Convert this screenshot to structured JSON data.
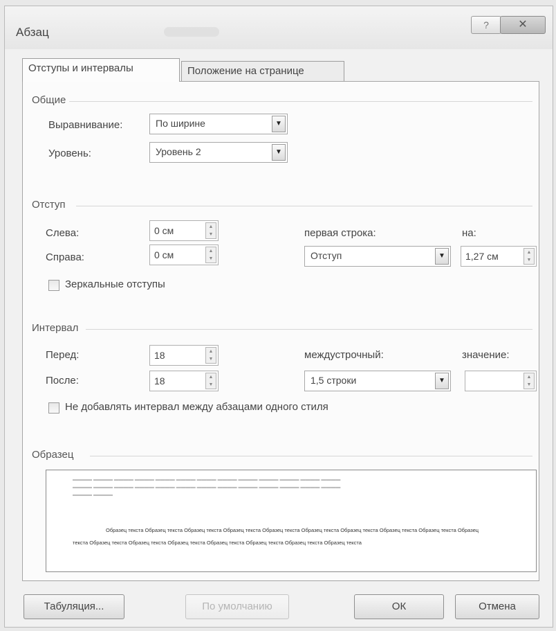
{
  "window": {
    "title": "Абзац",
    "help_icon": "?",
    "close_icon": "✕"
  },
  "tabs": [
    {
      "label": "Отступы и интервалы",
      "active": true
    },
    {
      "label": "Положение на странице",
      "active": false
    }
  ],
  "general": {
    "section": "Общие",
    "alignment_label": "Выравнивание:",
    "alignment_value": "По ширине",
    "level_label": "Уровень:",
    "level_value": "Уровень 2"
  },
  "indent": {
    "section": "Отступ",
    "left_label": "Слева:",
    "left_value": "0 см",
    "right_label": "Справа:",
    "right_value": "0 см",
    "first_line_label": "первая строка:",
    "first_line_value": "Отступ",
    "by_label": "на:",
    "by_value": "1,27 см",
    "mirror_label": "Зеркальные отступы"
  },
  "spacing": {
    "section": "Интервал",
    "before_label": "Перед:",
    "before_value": "18",
    "after_label": "После:",
    "after_value": "18",
    "line_label": "междустрочный:",
    "line_value": "1,5 строки",
    "at_label": "значение:",
    "at_value": "",
    "no_space_label": "Не добавлять интервал между абзацами одного стиля"
  },
  "preview": {
    "section": "Образец",
    "sample_text": "Образец текста Образец текста Образец текста Образец текста Образец текста Образец текста Образец текста Образец текста Образец текста Образец текста Образец текста Образец текста Образец текста Образец текста Образец текста Образец текста Образец текста"
  },
  "buttons": {
    "tabs": "Табуляция...",
    "default": "По умолчанию",
    "ok": "ОК",
    "cancel": "Отмена"
  },
  "icons": {
    "dropdown": "chevron-down-icon",
    "spinner": "spinner-arrows-icon"
  }
}
